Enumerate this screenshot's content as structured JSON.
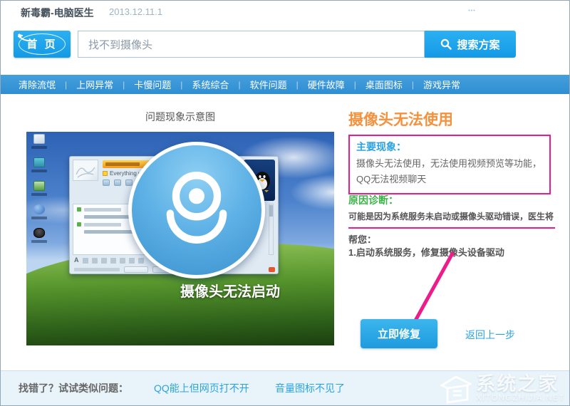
{
  "window": {
    "title": "新毒霸-电脑医生",
    "version": "2013.12.11.1",
    "controls": {
      "feedback_icon": "speech-bubble",
      "skin_icon": "chevron-down",
      "minimize_icon": "minimize-bar",
      "close_icon": "close-x"
    }
  },
  "search": {
    "home_label": "首 页",
    "query_value": "找不到摄像头",
    "button_label": "搜索方案",
    "button_icon": "magnifier"
  },
  "nav": {
    "items": [
      {
        "label": "清除流氓"
      },
      {
        "label": "上网异常"
      },
      {
        "label": "卡慢问题"
      },
      {
        "label": "系统综合"
      },
      {
        "label": "软件问题"
      },
      {
        "label": "硬件故障"
      },
      {
        "label": "桌面图标"
      },
      {
        "label": "游戏异常"
      }
    ],
    "separator": "|"
  },
  "figure": {
    "title": "问题现象示意图",
    "caption": "摄像头无法启动",
    "webcam_icon": "webcam-glyph",
    "qq_signature": "Everything would gonna be OK",
    "desktop_icons": [
      "document",
      "my-computer",
      "recycle-bin",
      "network",
      "qq"
    ]
  },
  "solution": {
    "title": "摄像头无法使用",
    "symptom_label": "主要现象：",
    "symptom_text": "摄像头无法使用，无法使用视频预览等功能，QQ无法视频聊天",
    "diagnosis_label": "原因诊断：",
    "diagnosis_line1": "可能是因为系统服务未启动或摄像头驱动错误，医生将",
    "diagnosis_line2": "帮您：",
    "step1": "1.启动系统服务，修复摄像头设备驱动",
    "fix_button_label": "立即修复",
    "back_link_label": "返回上一步"
  },
  "footer": {
    "prompt": "找错了？试试类似问题：",
    "links": [
      {
        "label": "QQ能上但网页打不开"
      },
      {
        "label": "音量图标不见了"
      }
    ]
  },
  "watermark": {
    "name": "系统之家",
    "domain": "XITONGZHIJIA.NET",
    "icon": "house-logo"
  },
  "colors": {
    "accent_blue": "#1e9ade",
    "nav_blue": "#3596d8",
    "heading_orange": "#f5913d",
    "label_blue": "#29a3e4",
    "label_green": "#3bb44a",
    "annotation_magenta": "#ec1d8a",
    "body_gray": "#666666",
    "footer_bg": "#e9f3fa"
  }
}
